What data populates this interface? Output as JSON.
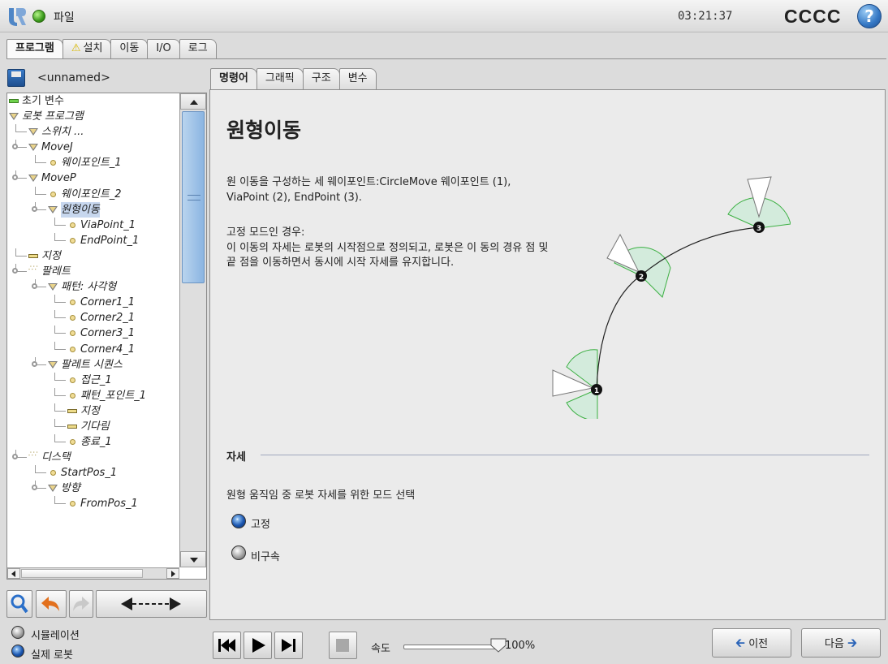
{
  "header": {
    "file_menu": "파일",
    "clock": "03:21:37",
    "robot_name": "CCCC",
    "help": "?"
  },
  "main_tabs": [
    "프로그램",
    "설치",
    "이동",
    "I/O",
    "로그"
  ],
  "install_warning": "⚠",
  "program_name": "<unnamed>",
  "tree": [
    {
      "label": "초기 변수",
      "indent": 0,
      "icon": "bar-green",
      "bold": true
    },
    {
      "label": "로봇 프로그램",
      "indent": 0,
      "icon": "triangle"
    },
    {
      "label": "스위치 ...",
      "indent": 1,
      "icon": "triangle"
    },
    {
      "label": "MoveJ",
      "indent": 1,
      "icon": "triangle",
      "joint": true
    },
    {
      "label": "웨이포인트_1",
      "indent": 2,
      "icon": "dot"
    },
    {
      "label": "MoveP",
      "indent": 1,
      "icon": "triangle",
      "joint": true
    },
    {
      "label": "웨이포인트_2",
      "indent": 2,
      "icon": "dot"
    },
    {
      "label": "원형이동",
      "indent": 2,
      "icon": "triangle",
      "joint": true,
      "selected": true
    },
    {
      "label": "ViaPoint_1",
      "indent": 3,
      "icon": "dot"
    },
    {
      "label": "EndPoint_1",
      "indent": 3,
      "icon": "dot"
    },
    {
      "label": "지정",
      "indent": 1,
      "icon": "bar"
    },
    {
      "label": "팔레트",
      "indent": 1,
      "icon": "pallet",
      "joint": true
    },
    {
      "label": "패턴: 사각형",
      "indent": 2,
      "icon": "triangle",
      "joint": true
    },
    {
      "label": "Corner1_1",
      "indent": 3,
      "icon": "dot"
    },
    {
      "label": "Corner2_1",
      "indent": 3,
      "icon": "dot"
    },
    {
      "label": "Corner3_1",
      "indent": 3,
      "icon": "dot"
    },
    {
      "label": "Corner4_1",
      "indent": 3,
      "icon": "dot"
    },
    {
      "label": "팔레트 시퀀스",
      "indent": 2,
      "icon": "triangle",
      "joint": true
    },
    {
      "label": "접근_1",
      "indent": 3,
      "icon": "dot"
    },
    {
      "label": "패턴_포인트_1",
      "indent": 3,
      "icon": "dot"
    },
    {
      "label": "지정",
      "indent": 3,
      "icon": "bar"
    },
    {
      "label": "기다림",
      "indent": 3,
      "icon": "bar"
    },
    {
      "label": "종료_1",
      "indent": 3,
      "icon": "dot"
    },
    {
      "label": "디스택",
      "indent": 1,
      "icon": "pallet",
      "joint": true
    },
    {
      "label": "StartPos_1",
      "indent": 2,
      "icon": "dot"
    },
    {
      "label": "방향",
      "indent": 2,
      "icon": "triangle",
      "joint": true
    },
    {
      "label": "FromPos_1",
      "indent": 3,
      "icon": "dot"
    }
  ],
  "sub_tabs": [
    "명령어",
    "그래픽",
    "구조",
    "변수"
  ],
  "panel": {
    "title": "원형이동",
    "desc1": "원 이동을 구성하는 세 웨이포인트:CircleMove 웨이포인트 (1), ViaPoint (2), EndPoint (3).",
    "desc2_title": "고정 모드인 경우:",
    "desc2": "이 이동의 자세는 로봇의 시작점으로 정의되고, 로봇은 이 동의 경유 점 및 끝 점을 이동하면서 동시에 시작 자세를 유지합니다.",
    "points": [
      "1",
      "2",
      "3"
    ],
    "section": "자세",
    "mode_text": "원형 움직임 중 로봇 자세를 위한 모드 선택",
    "mode_options": [
      {
        "label": "고정",
        "selected": true
      },
      {
        "label": "비구속",
        "selected": false
      }
    ]
  },
  "bottom": {
    "sim_label": "시뮬레이션",
    "real_label": "실제 로봇",
    "speed_label": "속도",
    "speed_value": "100%",
    "speed": 1.0,
    "prev_label": "이전",
    "next_label": "다음"
  },
  "colors": {
    "selection": "#c7d7ee",
    "sector_fill": "#d3ebdc",
    "sector_stroke": "#3cb043",
    "accent": "#1b56b0"
  }
}
